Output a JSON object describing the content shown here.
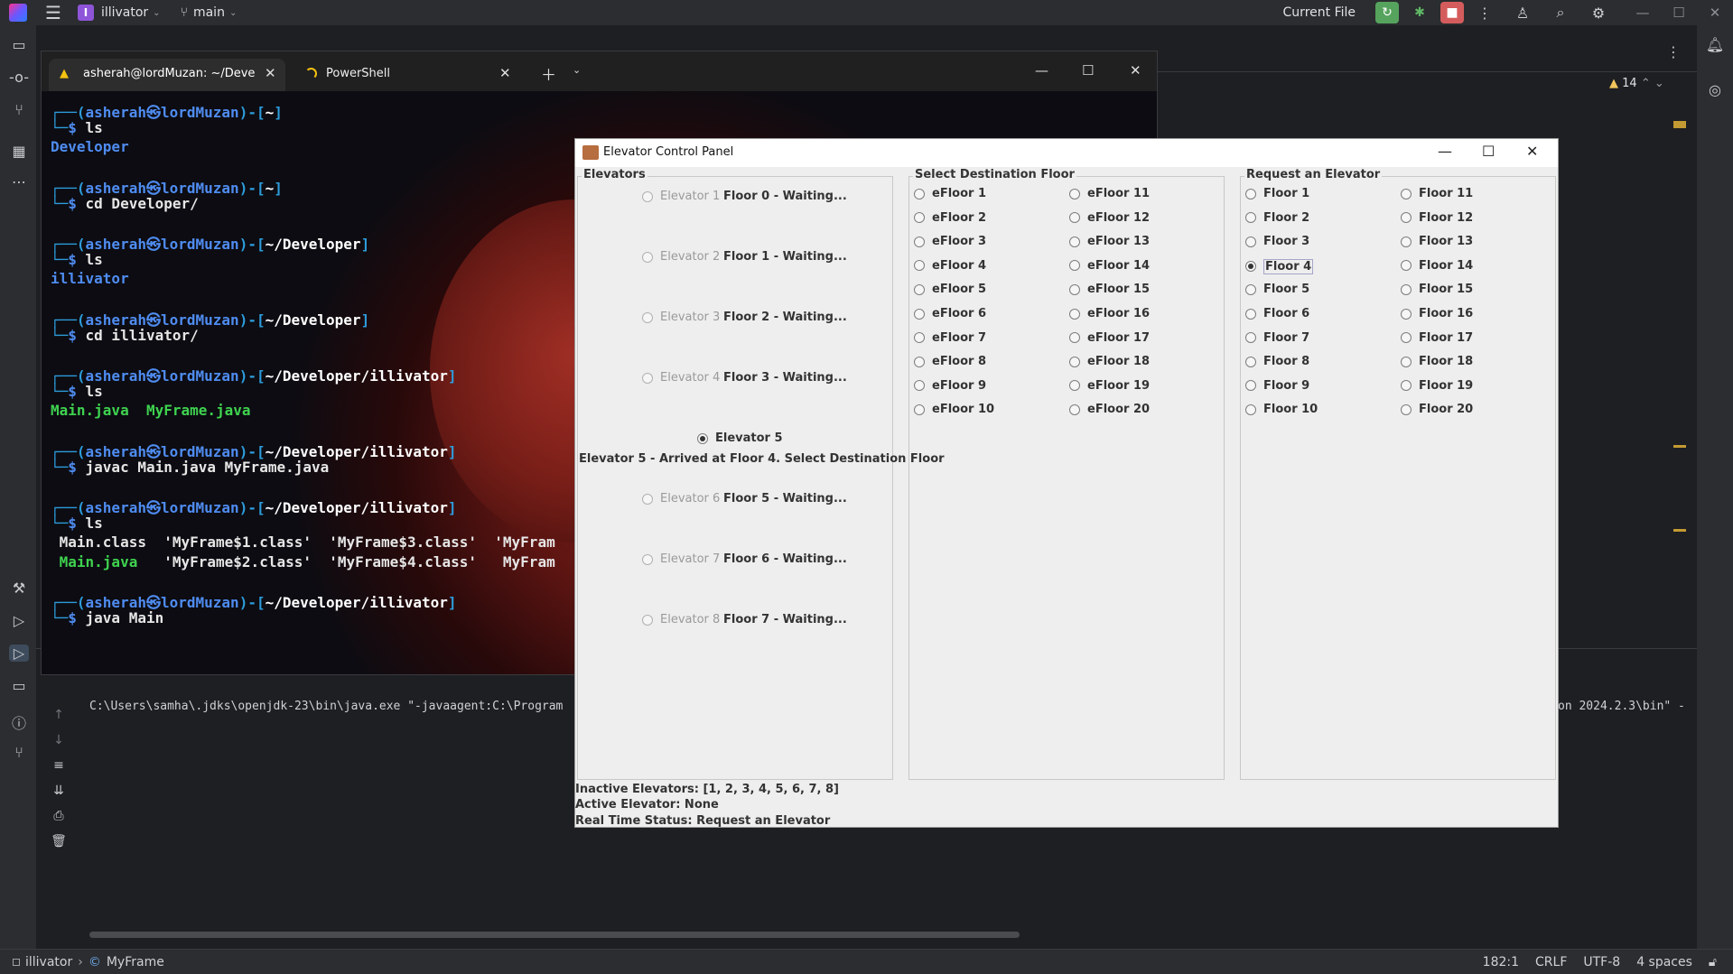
{
  "ide": {
    "project": "illivator",
    "project_initial": "I",
    "branch": "main",
    "run_config": "Current File",
    "warnings_count": "14",
    "console_line": "C:\\Users\\samha\\.jdks\\openjdk-23\\bin\\java.exe \"-javaagent:C:\\Program",
    "console_line_tail": "on 2024.2.3\\bin\" -",
    "status": {
      "breadcrumb_project": "illivator",
      "breadcrumb_file": "MyFrame",
      "position": "182:1",
      "line_ending": "CRLF",
      "encoding": "UTF-8",
      "indent": "4 spaces"
    }
  },
  "terminal": {
    "tabs": [
      {
        "title": "asherah@lordMuzan: ~/Devel"
      },
      {
        "title": "PowerShell"
      }
    ],
    "lines": [
      {
        "kind": "prompt",
        "user": "asherah",
        "sep": "㉿",
        "host": "lordMuzan",
        "path": "~"
      },
      {
        "kind": "cmd",
        "text": "ls"
      },
      {
        "kind": "out",
        "text": "Developer",
        "style": "dir"
      },
      {
        "kind": "prompt",
        "user": "asherah",
        "sep": "㉿",
        "host": "lordMuzan",
        "path": "~"
      },
      {
        "kind": "cmd",
        "text": "cd Developer/"
      },
      {
        "kind": "prompt",
        "user": "asherah",
        "sep": "㉿",
        "host": "lordMuzan",
        "path": "~/Developer"
      },
      {
        "kind": "cmd",
        "text": "ls"
      },
      {
        "kind": "out",
        "text": "illivator",
        "style": "dir"
      },
      {
        "kind": "prompt",
        "user": "asherah",
        "sep": "㉿",
        "host": "lordMuzan",
        "path": "~/Developer"
      },
      {
        "kind": "cmd",
        "text": "cd illivator/"
      },
      {
        "kind": "prompt",
        "user": "asherah",
        "sep": "㉿",
        "host": "lordMuzan",
        "path": "~/Developer/illivator"
      },
      {
        "kind": "cmd",
        "text": "ls"
      },
      {
        "kind": "out",
        "text": "Main.java  MyFrame.java",
        "style": "java"
      },
      {
        "kind": "prompt",
        "user": "asherah",
        "sep": "㉿",
        "host": "lordMuzan",
        "path": "~/Developer/illivator"
      },
      {
        "kind": "cmd",
        "text": "javac Main.java MyFrame.java"
      },
      {
        "kind": "prompt",
        "user": "asherah",
        "sep": "㉿",
        "host": "lordMuzan",
        "path": "~/Developer/illivator"
      },
      {
        "kind": "cmd",
        "text": "ls"
      },
      {
        "kind": "out",
        "text": " Main.class  'MyFrame$1.class'  'MyFrame$3.class'  'MyFram",
        "style": "plain"
      },
      {
        "kind": "out",
        "text": " Main.java   'MyFrame$2.class'  'MyFrame$4.class'   MyFram",
        "style": "mixed"
      },
      {
        "kind": "prompt",
        "user": "asherah",
        "sep": "㉿",
        "host": "lordMuzan",
        "path": "~/Developer/illivator"
      },
      {
        "kind": "cmd",
        "text": "java Main"
      }
    ]
  },
  "elevator_app": {
    "title": "Elevator Control Panel",
    "elevators_title": "Elevators",
    "dest_title": "Select Destination Floor",
    "request_title": "Request an Elevator",
    "elevators": [
      {
        "name": "Elevator 1",
        "status": "Floor 0 - Waiting...",
        "selected": false
      },
      {
        "name": "Elevator 2",
        "status": "Floor 1 - Waiting...",
        "selected": false
      },
      {
        "name": "Elevator 3",
        "status": "Floor 2 - Waiting...",
        "selected": false
      },
      {
        "name": "Elevator 4",
        "status": "Floor 3 - Waiting...",
        "selected": false
      },
      {
        "name": "Elevator 5",
        "status": "Elevator 5 - Arrived at Floor 4. Select Destination Floor",
        "selected": true
      },
      {
        "name": "Elevator 6",
        "status": "Floor 5 - Waiting...",
        "selected": false
      },
      {
        "name": "Elevator 7",
        "status": "Floor 6 - Waiting...",
        "selected": false
      },
      {
        "name": "Elevator 8",
        "status": "Floor 7 - Waiting...",
        "selected": false
      }
    ],
    "dest_floors": [
      "eFloor 1",
      "eFloor 2",
      "eFloor 3",
      "eFloor 4",
      "eFloor 5",
      "eFloor 6",
      "eFloor 7",
      "eFloor 8",
      "eFloor 9",
      "eFloor 10",
      "eFloor 11",
      "eFloor 12",
      "eFloor 13",
      "eFloor 14",
      "eFloor 15",
      "eFloor 16",
      "eFloor 17",
      "eFloor 18",
      "eFloor 19",
      "eFloor 20"
    ],
    "request_floors": [
      "Floor 1",
      "Floor 2",
      "Floor 3",
      "Floor 4",
      "Floor 5",
      "Floor 6",
      "Floor 7",
      "Floor 8",
      "Floor 9",
      "Floor 10",
      "Floor 11",
      "Floor 12",
      "Floor 13",
      "Floor 14",
      "Floor 15",
      "Floor 16",
      "Floor 17",
      "Floor 18",
      "Floor 19",
      "Floor 20"
    ],
    "request_selected": "Floor 4",
    "inactive": "Inactive Elevators: [1, 2, 3, 4, 5, 6, 7, 8]",
    "active": "Active Elevator: None",
    "realtime": "Real Time Status: Request an Elevator"
  }
}
